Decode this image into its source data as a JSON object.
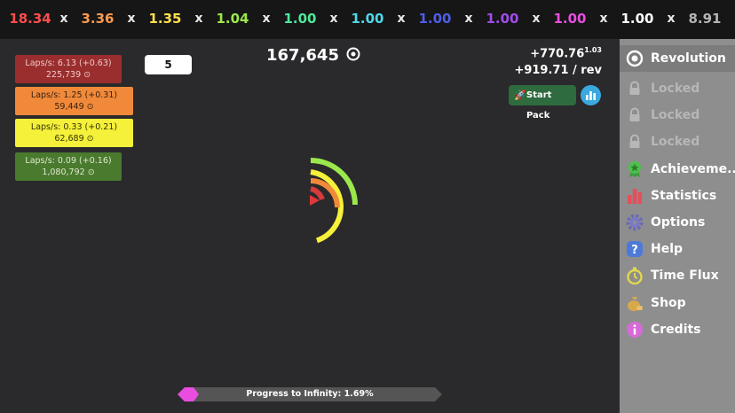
{
  "multipliers": [
    {
      "value": "18.34",
      "color": "#ff4d4d"
    },
    {
      "value": "3.36",
      "color": "#ff9a4d"
    },
    {
      "value": "1.35",
      "color": "#ffe04d"
    },
    {
      "value": "1.04",
      "color": "#9be84d"
    },
    {
      "value": "1.00",
      "color": "#4de89a"
    },
    {
      "value": "1.00",
      "color": "#4dd8e8"
    },
    {
      "value": "1.00",
      "color": "#4d5de8"
    },
    {
      "value": "1.00",
      "color": "#a04de8"
    },
    {
      "value": "1.00",
      "color": "#e84de0"
    },
    {
      "value": "1.00",
      "color": "#ffffff"
    },
    {
      "value": "8.91",
      "color": "#b5b5b5"
    }
  ],
  "separator": "x",
  "upgrades": [
    {
      "line1": "Laps/s: 6.13 (+0.63)",
      "line2": "225,739 ⊙",
      "bg": "#9a2e2e",
      "fg": "#f0c8c8"
    },
    {
      "line1": "Laps/s: 1.25 (+0.31)",
      "line2": "59,449 ⊙",
      "bg": "#f08a3a",
      "fg": "#3a2010"
    },
    {
      "line1": "Laps/s: 0.33 (+0.21)",
      "line2": "62,689 ⊙",
      "bg": "#f5f03a",
      "fg": "#333300"
    },
    {
      "line1": "Laps/s: 0.09 (+0.16)",
      "line2": "1,080,792 ⊙",
      "bg": "#4a7a2e",
      "fg": "#dfe8d0"
    }
  ],
  "buy_amount": "5",
  "counter": "167,645",
  "rates": {
    "line1": "+770.76",
    "line1_sup": "1.03",
    "line2": "+919.71 / rev"
  },
  "start_pack_label": "Start Pack",
  "progress": {
    "label": "Progress to Infinity: 1.69%",
    "fraction": 0.0169
  },
  "sidebar": [
    {
      "label": "Revolution",
      "icon": "target-icon",
      "locked": false,
      "active": true
    },
    {
      "label": "Locked",
      "icon": "lock-icon",
      "locked": true
    },
    {
      "label": "Locked",
      "icon": "lock-icon",
      "locked": true
    },
    {
      "label": "Locked",
      "icon": "lock-icon",
      "locked": true
    },
    {
      "label": "Achieveme...",
      "icon": "ribbon-icon",
      "locked": false
    },
    {
      "label": "Statistics",
      "icon": "bar-chart-icon",
      "locked": false
    },
    {
      "label": "Options",
      "icon": "gear-icon",
      "locked": false
    },
    {
      "label": "Help",
      "icon": "question-icon",
      "locked": false
    },
    {
      "label": "Time Flux",
      "icon": "stopwatch-icon",
      "locked": false
    },
    {
      "label": "Shop",
      "icon": "money-bag-icon",
      "locked": false
    },
    {
      "label": "Credits",
      "icon": "info-icon",
      "locked": false
    }
  ]
}
